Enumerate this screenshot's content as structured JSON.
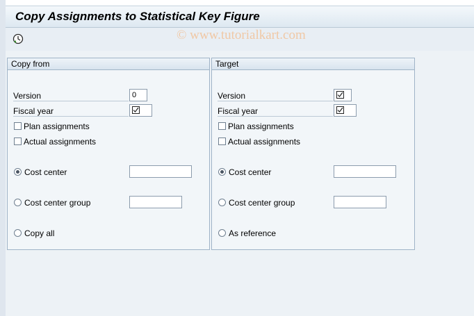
{
  "window": {
    "title": "Copy Assignments to Statistical Key Figure",
    "watermark": "© www.tutorialkart.com"
  },
  "toolbar": {
    "execute_icon": "execute-clock-icon"
  },
  "copy_from": {
    "title": "Copy from",
    "version_label": "Version",
    "version_value": "0",
    "fiscal_year_label": "Fiscal year",
    "fiscal_year_value": "",
    "fiscal_year_icon": "checkbox-required-icon",
    "plan_label": "Plan assignments",
    "plan_checked": false,
    "actual_label": "Actual assignments",
    "actual_checked": false,
    "cost_center_label": "Cost center",
    "cost_center_value": "",
    "cost_center_selected": true,
    "cost_center_group_label": "Cost center group",
    "cost_center_group_value": "",
    "copy_all_label": "Copy all"
  },
  "target": {
    "title": "Target",
    "version_label": "Version",
    "version_value": "",
    "version_icon": "checkbox-required-icon",
    "fiscal_year_label": "Fiscal year",
    "fiscal_year_value": "",
    "fiscal_year_icon": "checkbox-required-icon",
    "plan_label": "Plan assignments",
    "plan_checked": false,
    "actual_label": "Actual assignments",
    "actual_checked": false,
    "cost_center_label": "Cost center",
    "cost_center_value": "",
    "cost_center_selected": true,
    "cost_center_group_label": "Cost center group",
    "cost_center_group_value": "",
    "as_reference_label": "As reference"
  },
  "colors": {
    "title_bar": "#dde8f1",
    "background": "#edf2f6",
    "group_border": "#9fb3c7",
    "watermark": "#f0c8a5"
  }
}
